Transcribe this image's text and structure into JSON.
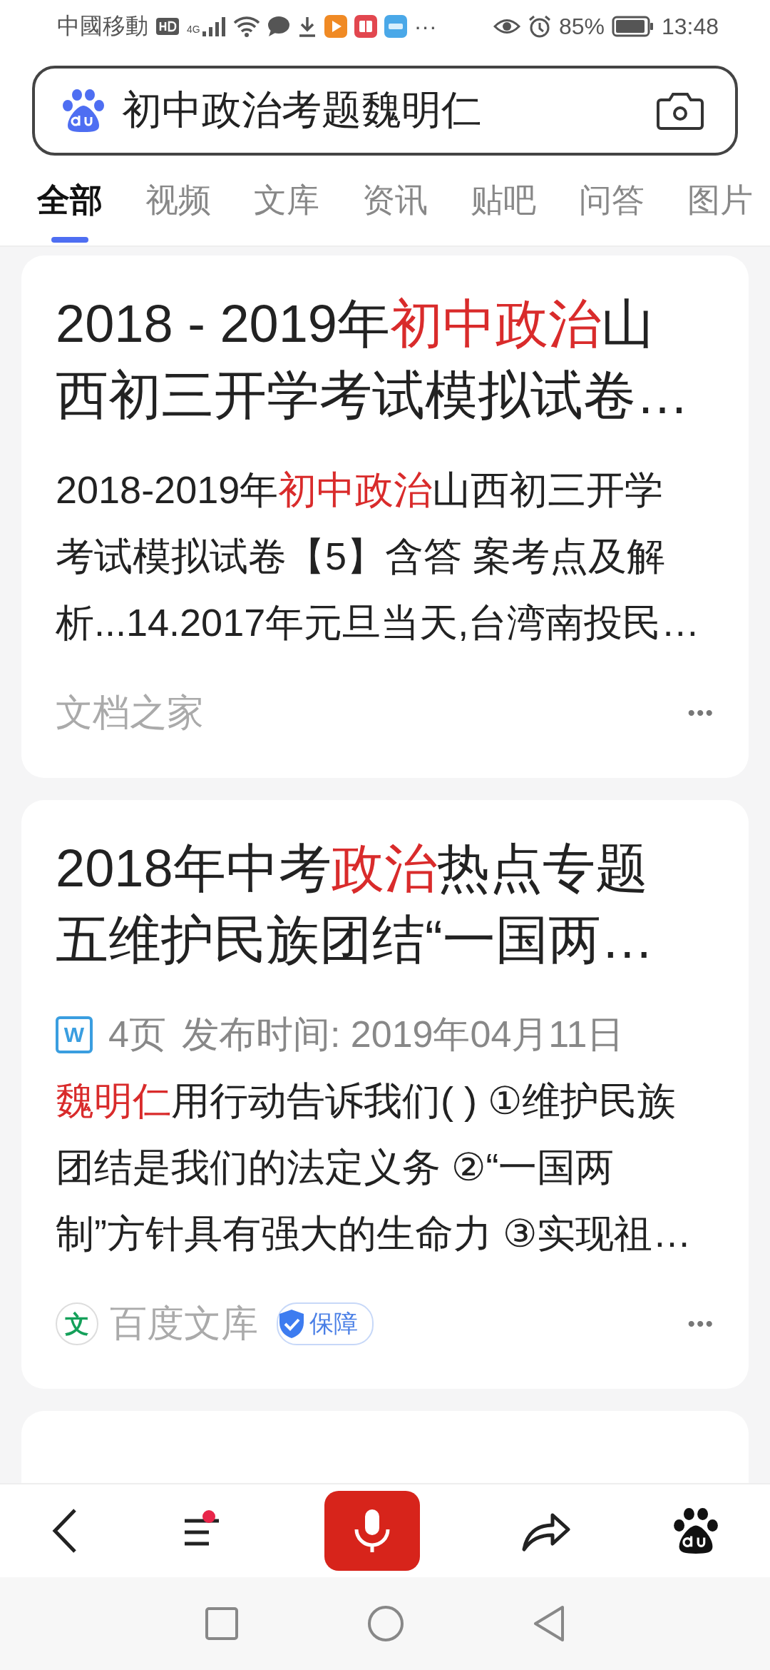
{
  "status_bar": {
    "carrier": "中國移動",
    "network": "4G",
    "more": "···",
    "battery_percent": "85%",
    "time": "13:48"
  },
  "search": {
    "value": "初中政治考题魏明仁"
  },
  "tabs": [
    {
      "label": "全部",
      "selected": true
    },
    {
      "label": "视频",
      "selected": false
    },
    {
      "label": "文库",
      "selected": false
    },
    {
      "label": "资讯",
      "selected": false
    },
    {
      "label": "贴吧",
      "selected": false
    },
    {
      "label": "问答",
      "selected": false
    },
    {
      "label": "图片",
      "selected": false
    }
  ],
  "results": [
    {
      "title_lines": [
        [
          {
            "text": "2018 - 2019年",
            "highlight": false
          },
          {
            "text": "初中政治",
            "highlight": true
          },
          {
            "text": "山",
            "highlight": false
          }
        ],
        [
          {
            "text": "西初三开学考试模拟试卷…",
            "highlight": false
          }
        ]
      ],
      "snippet_lines": [
        [
          {
            "text": "2018-2019年",
            "highlight": false
          },
          {
            "text": "初中政治",
            "highlight": true
          },
          {
            "text": "山西初三开学",
            "highlight": false
          }
        ],
        [
          {
            "text": "考试模拟试卷【5】含答 案考点及解",
            "highlight": false
          }
        ],
        [
          {
            "text": "析...14.2017年元旦当天,台湾南投民…",
            "highlight": false
          }
        ]
      ],
      "source": {
        "name": "文档之家"
      },
      "more": "•••"
    },
    {
      "title_lines": [
        [
          {
            "text": "2018年中考",
            "highlight": false
          },
          {
            "text": "政治",
            "highlight": true
          },
          {
            "text": "热点专题",
            "highlight": false
          }
        ],
        [
          {
            "text": "五维护民族团结“一国两…",
            "highlight": false
          }
        ]
      ],
      "meta": {
        "file_icon": "W",
        "pages": "4页",
        "published": "发布时间: 2019年04月11日"
      },
      "snippet_lines": [
        [
          {
            "text": "魏明仁",
            "highlight": true
          },
          {
            "text": "用行动告诉我们( ) ①维护民族",
            "highlight": false
          }
        ],
        [
          {
            "text": "团结是我们的法定义务 ②“一国两",
            "highlight": false
          }
        ],
        [
          {
            "text": "制”方针具有强大的生命力 ③实现祖…",
            "highlight": false
          }
        ]
      ],
      "source": {
        "icon_text": "文",
        "name": "百度文库",
        "badge": "保障"
      },
      "more": "•••"
    }
  ],
  "next_card_peeking": true
}
